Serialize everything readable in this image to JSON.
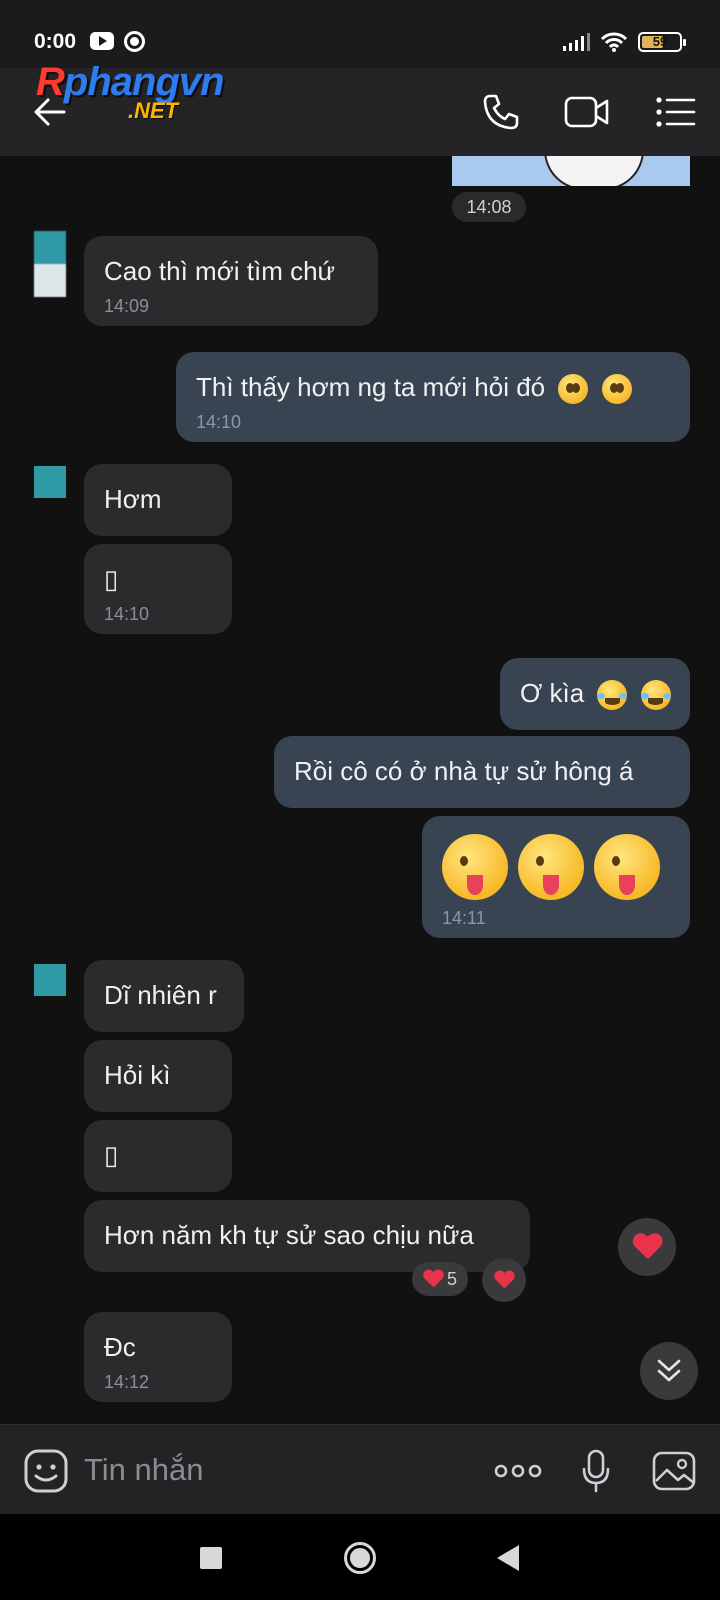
{
  "status_bar": {
    "time": "0:00",
    "battery_level": "59",
    "battery_fraction": 0.59
  },
  "header": {
    "watermark_line1": "Rphangvn",
    "watermark_line2": ".NET",
    "icons": [
      "back-arrow-icon",
      "phone-icon",
      "video-call-icon",
      "menu-list-icon"
    ]
  },
  "messages": {
    "image_time": "14:08",
    "m1": {
      "text": "Cao thì mới tìm chứ",
      "time": "14:09"
    },
    "m2": {
      "text": "Thì thấy hơm ng ta mới hỏi đó",
      "time": "14:10",
      "emojis": [
        "hand-over-mouth-emoji",
        "hand-over-mouth-emoji"
      ]
    },
    "m3": {
      "text": "Hơm"
    },
    "m4": {
      "text": "▯",
      "time": "14:10"
    },
    "m5": {
      "text": "Ơ kìa",
      "emojis": [
        "tears-of-joy-emoji",
        "tears-of-joy-emoji"
      ]
    },
    "m6": {
      "text": "Rồi cô có ở nhà tự sử hông á"
    },
    "m7": {
      "emojis": [
        "winking-tongue-emoji",
        "winking-tongue-emoji",
        "winking-tongue-emoji"
      ],
      "time": "14:11"
    },
    "m8": {
      "text": "Dĩ nhiên r"
    },
    "m9": {
      "text": "Hỏi kì"
    },
    "m10": {
      "text": "▯"
    },
    "m11": {
      "text": "Hơn năm kh tự sử sao chịu nữa",
      "reaction_count": "5"
    },
    "m12": {
      "text": "Đc",
      "time": "14:12"
    }
  },
  "composer": {
    "placeholder": "Tin nhắn"
  },
  "colors": {
    "background": "#111112",
    "bubble_in": "#2b2b2d",
    "bubble_out": "#394452",
    "heart": "#e8334a"
  }
}
